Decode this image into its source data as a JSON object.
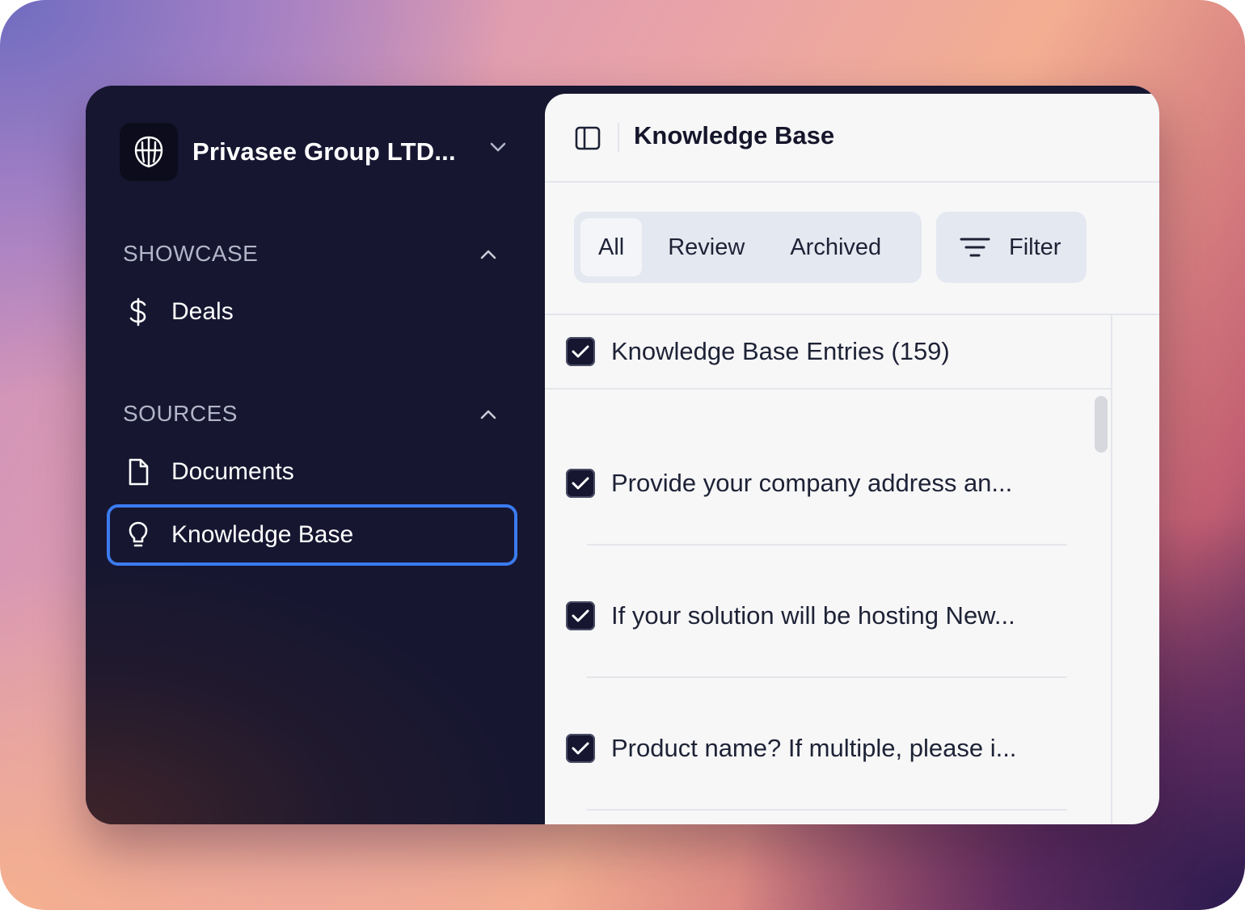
{
  "sidebar": {
    "org_name": "Privasee Group LTD...",
    "sections": [
      {
        "title": "SHOWCASE",
        "items": [
          {
            "label": "Deals",
            "icon": "dollar-icon"
          }
        ]
      },
      {
        "title": "SOURCES",
        "items": [
          {
            "label": "Documents",
            "icon": "document-icon"
          },
          {
            "label": "Knowledge Base",
            "icon": "lightbulb-icon",
            "active": true
          }
        ]
      }
    ]
  },
  "main": {
    "title": "Knowledge Base",
    "tabs": [
      {
        "label": "All",
        "active": true
      },
      {
        "label": "Review"
      },
      {
        "label": "Archived"
      }
    ],
    "filter_label": "Filter",
    "list_header": "Knowledge Base Entries (159)",
    "entries": [
      "Provide your company address an...",
      "If your solution will be hosting New...",
      "Product name? If multiple, please i..."
    ]
  },
  "colors": {
    "sidebar_bg": "#161631",
    "active_outline": "#3b7bf0",
    "main_bg": "#f7f7f8",
    "checkbox": "#161631"
  }
}
